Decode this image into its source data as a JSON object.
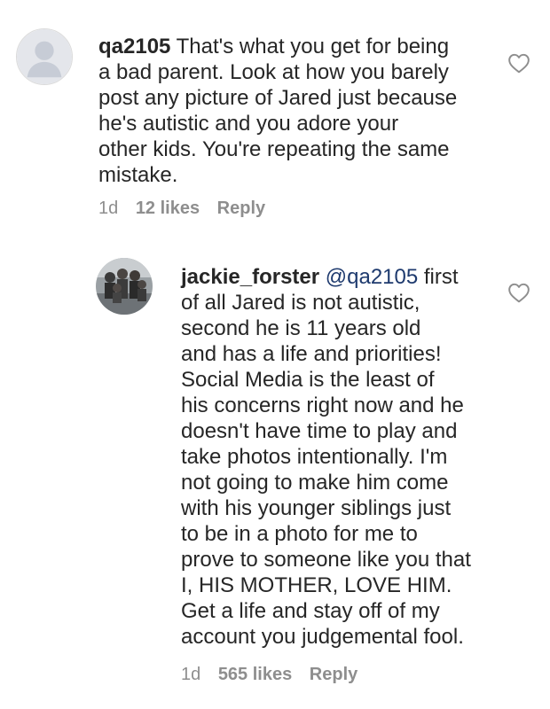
{
  "comments": [
    {
      "username": "qa2105",
      "mention": "",
      "text_lines": [
        " That's what you get for being",
        "a bad parent. Look at how you barely",
        "post any picture of Jared just because",
        "he's autistic and you adore your",
        "other kids. You're repeating the same",
        "mistake."
      ],
      "time": "1d",
      "likes": "12 likes",
      "reply": "Reply",
      "avatar_icon": "default-avatar-icon",
      "like_icon": "heart-outline-icon"
    },
    {
      "username": "jackie_forster",
      "mention": "@qa2105",
      "first_line_rest": " first",
      "text_lines": [
        "of all Jared is not autistic,",
        "second he is 11 years old",
        "and has a life and priorities!",
        "Social Media is the least of",
        "his concerns right now and he",
        "doesn't have time to play and",
        "take photos intentionally. I'm",
        "not going to make him come",
        "with his younger siblings just",
        "to be in a photo for me to",
        "prove to someone like you that",
        "I, HIS MOTHER, LOVE HIM.",
        "Get a life and stay off of my",
        "account you judgemental fool."
      ],
      "time": "1d",
      "likes": "565 likes",
      "reply": "Reply",
      "avatar_icon": "family-photo-avatar",
      "like_icon": "heart-outline-icon"
    }
  ],
  "colors": {
    "text": "#262626",
    "meta": "#8e8e8e",
    "mention": "#1e3a6e",
    "avatar_bg": "#dbdbdb"
  }
}
